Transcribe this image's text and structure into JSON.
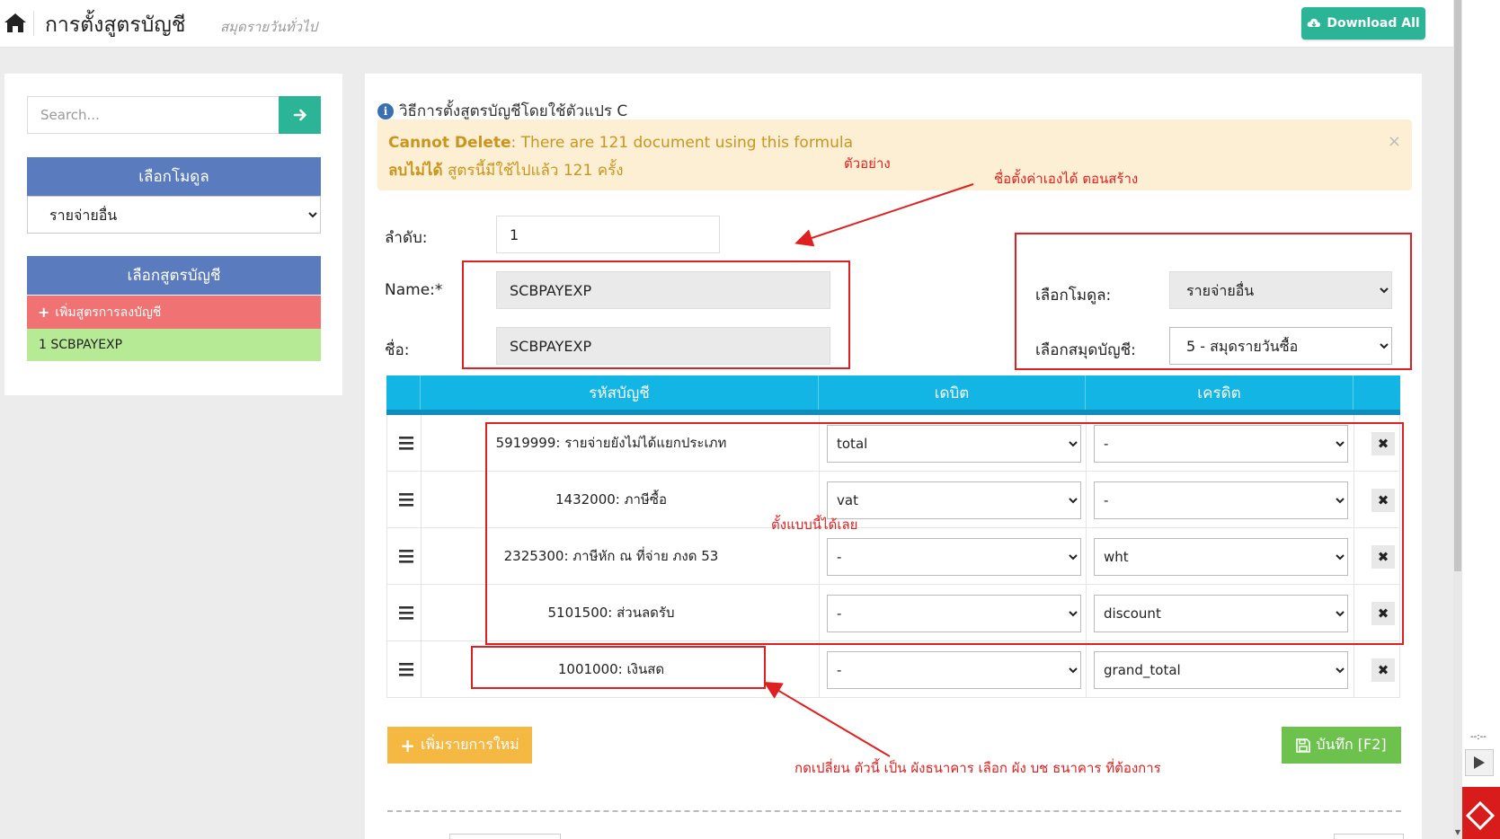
{
  "header": {
    "title": "การตั้งสูตรบัญชี",
    "subtitle": "สมุดรายวันทั่วไป",
    "download_label": "Download All"
  },
  "sidebar": {
    "search_placeholder": "Search...",
    "module_heading": "เลือกโมดูล",
    "module_selected": "รายจ่ายอื่น",
    "formula_heading": "เลือกสูตรบัญชี",
    "add_formula_label": "เพิ่มสูตรการลงบัญชี",
    "formulas": [
      {
        "label": "1 SCBPAYEXP"
      }
    ]
  },
  "main": {
    "help_text": "วิธีการตั้งสูตรบัญชีโดยใช้ตัวแปร C",
    "alert": {
      "line1_bold": "Cannot Delete",
      "line1_rest": ": There are 121 document using this formula",
      "line2_bold": "ลบไม่ได้",
      "line2_rest": " สูตรนี้มีใช้ไปแล้ว 121 ครั้ง",
      "close": "×"
    },
    "form": {
      "order_label": "ลำดับ:",
      "order_value": "1",
      "name_label": "Name:*",
      "name_value": "SCBPAYEXP",
      "thai_name_label": "ชื่อ:",
      "thai_name_value": "SCBPAYEXP",
      "module_label": "เลือกโมดูล:",
      "module_value": "รายจ่ายอื่น",
      "book_label": "เลือกสมุดบัญชี:",
      "book_value": "5 - สมุดรายวันซื้อ"
    },
    "table": {
      "headers": {
        "account": "รหัสบัญชี",
        "debit": "เดบิต",
        "credit": "เครดิต"
      },
      "rows": [
        {
          "account": "5919999: รายจ่ายยังไม่ได้แยกประเภท",
          "debit": "total",
          "credit": "-"
        },
        {
          "account": "1432000: ภาษีซื้อ",
          "debit": "vat",
          "credit": "-"
        },
        {
          "account": "2325300: ภาษีหัก ณ ที่จ่าย ภงด 53",
          "debit": "-",
          "credit": "wht"
        },
        {
          "account": "5101500: ส่วนลดรับ",
          "debit": "-",
          "credit": "discount"
        },
        {
          "account": "1001000: เงินสด",
          "debit": "-",
          "credit": "grand_total"
        }
      ],
      "delete_symbol": "✖"
    },
    "add_row_label": "เพิ่มรายการใหม่",
    "save_label": "บันทึก [F2]"
  },
  "annotations": {
    "example": "ตัวอย่าง",
    "name_note": "ชื่อตั้งค่าเองได้ ตอนสร้าง",
    "rows_note": "ตั้งแบบนี้ได้เลย",
    "bank_note": "กดเปลี่ยน ตัวนี้ เป็น ผังธนาคาร  เลือก ผัง บช ธนาคาร ที่ต้องการ",
    "color": "#e02020"
  },
  "media": {
    "time": "--:--"
  },
  "colors": {
    "accent_green": "#2bb596",
    "panel_blue": "#5a7cbf",
    "table_header": "#13b5e5",
    "add_red": "#f07272",
    "formula_green": "#b6ea95",
    "warning_bg": "#fcefd3",
    "add_row_yellow": "#f4b843",
    "save_green": "#6cc24d"
  }
}
